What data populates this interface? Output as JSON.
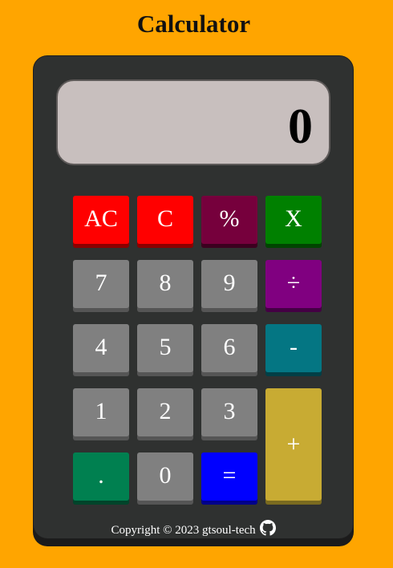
{
  "app": {
    "title": "Calculator"
  },
  "display": {
    "value": "0"
  },
  "keys": [
    {
      "label": "AC",
      "name": "all-clear-button",
      "color": "#ff0000",
      "shade": "#8b0000"
    },
    {
      "label": "C",
      "name": "clear-button",
      "color": "#ff0000",
      "shade": "#8b0000"
    },
    {
      "label": "%",
      "name": "percent-button",
      "color": "#76003c",
      "shade": "#3c001f"
    },
    {
      "label": "X",
      "name": "multiply-button",
      "color": "#008000",
      "shade": "#004400"
    },
    {
      "label": "7",
      "name": "digit-7-button",
      "color": "#808080",
      "shade": "#555555"
    },
    {
      "label": "8",
      "name": "digit-8-button",
      "color": "#808080",
      "shade": "#555555"
    },
    {
      "label": "9",
      "name": "digit-9-button",
      "color": "#808080",
      "shade": "#555555"
    },
    {
      "label": "÷",
      "name": "divide-button",
      "color": "#800080",
      "shade": "#440044"
    },
    {
      "label": "4",
      "name": "digit-4-button",
      "color": "#808080",
      "shade": "#555555"
    },
    {
      "label": "5",
      "name": "digit-5-button",
      "color": "#808080",
      "shade": "#555555"
    },
    {
      "label": "6",
      "name": "digit-6-button",
      "color": "#808080",
      "shade": "#555555"
    },
    {
      "label": "-",
      "name": "subtract-button",
      "color": "#047683",
      "shade": "#023f46"
    },
    {
      "label": "1",
      "name": "digit-1-button",
      "color": "#808080",
      "shade": "#555555"
    },
    {
      "label": "2",
      "name": "digit-2-button",
      "color": "#808080",
      "shade": "#555555"
    },
    {
      "label": "3",
      "name": "digit-3-button",
      "color": "#808080",
      "shade": "#555555"
    },
    {
      "label": "+",
      "name": "add-button",
      "color": "#c8ab33",
      "shade": "#7a6a1f"
    },
    {
      "label": ".",
      "name": "decimal-point-button",
      "color": "#008050",
      "shade": "#00442a"
    },
    {
      "label": "0",
      "name": "digit-0-button",
      "color": "#808080",
      "shade": "#555555"
    },
    {
      "label": "=",
      "name": "equals-button",
      "color": "#0000ff",
      "shade": "#00008b"
    }
  ],
  "footer": {
    "text": "Copyright © 2023 gtsoul-tech",
    "icon": "github-icon"
  }
}
